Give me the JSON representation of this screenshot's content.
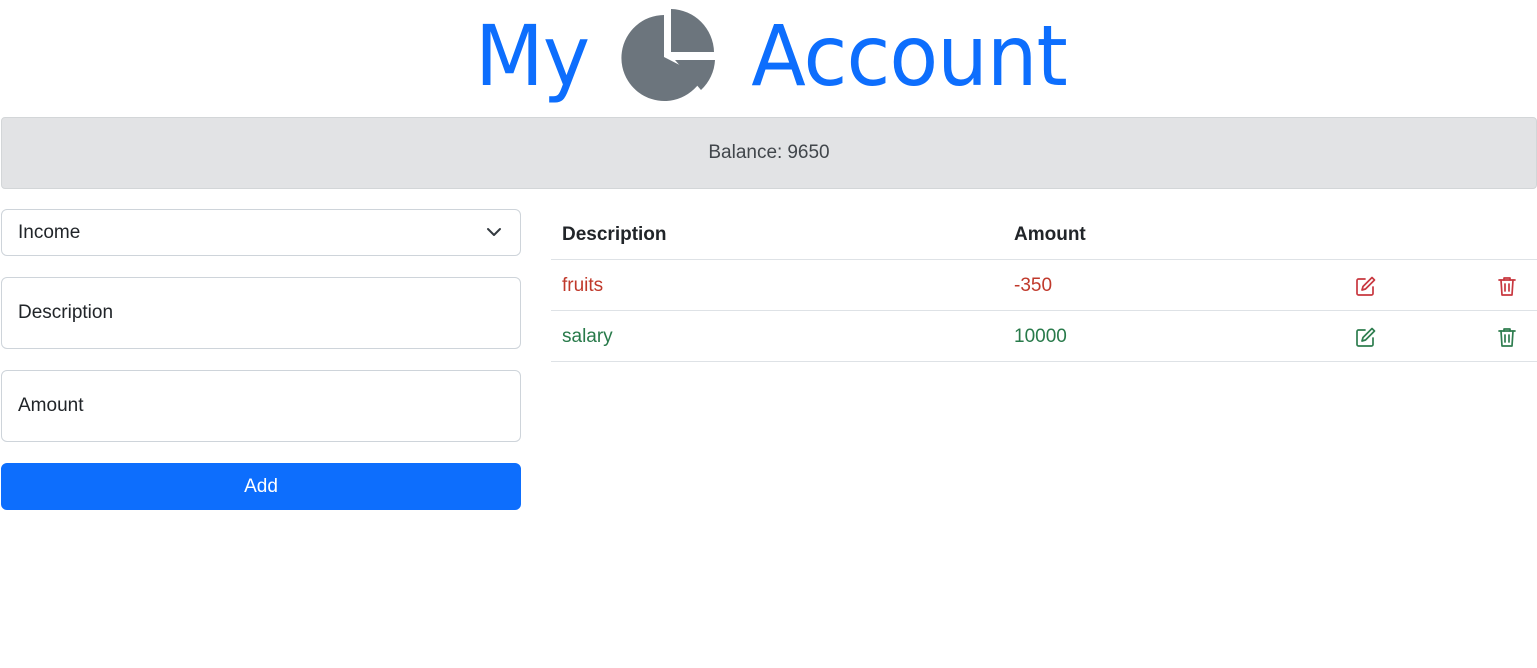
{
  "header": {
    "title_word1": "My",
    "title_word2": "Account",
    "icon": "pie-chart-icon",
    "accent_color": "#0d6efd"
  },
  "balance": {
    "label": "Balance:",
    "value": "9650"
  },
  "form": {
    "type_select": {
      "selected": "Income"
    },
    "description": {
      "placeholder": "Description"
    },
    "amount": {
      "placeholder": "Amount"
    },
    "add_label": "Add"
  },
  "table": {
    "headers": {
      "description": "Description",
      "amount": "Amount"
    },
    "rows": [
      {
        "description": "fruits",
        "amount": "-350",
        "kind": "expense",
        "color": "#c8373f",
        "edit_icon": "edit-icon",
        "delete_icon": "trash-icon"
      },
      {
        "description": "salary",
        "amount": "10000",
        "kind": "income",
        "color": "#2e7d4f",
        "edit_icon": "edit-icon",
        "delete_icon": "trash-icon"
      }
    ]
  }
}
